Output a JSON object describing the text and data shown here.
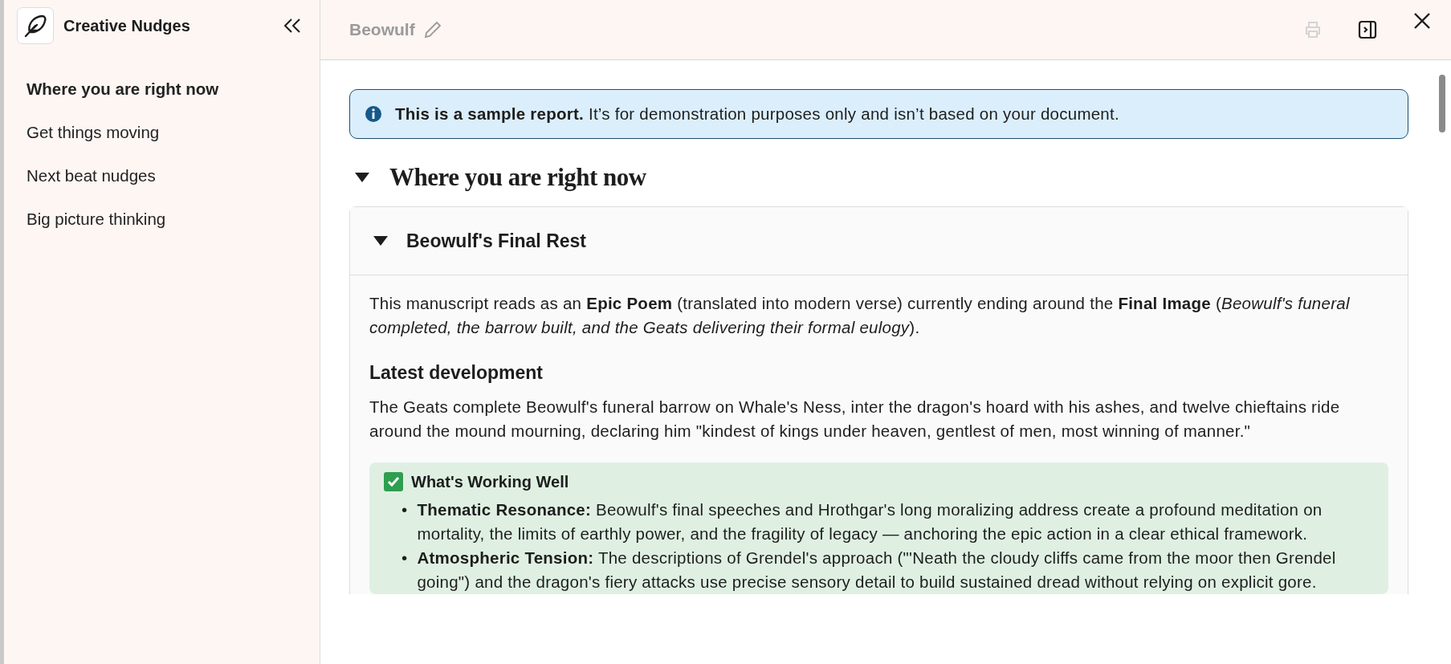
{
  "sidebar": {
    "title": "Creative Nudges",
    "items": [
      {
        "label": "Where you are right now",
        "selected": true
      },
      {
        "label": "Get things moving",
        "selected": false
      },
      {
        "label": "Next beat nudges",
        "selected": false
      },
      {
        "label": "Big picture thinking",
        "selected": false
      }
    ]
  },
  "header": {
    "title": "Beowulf",
    "actions": [
      {
        "kind": "print",
        "disabled": true
      },
      {
        "kind": "panel",
        "disabled": false
      },
      {
        "kind": "close",
        "disabled": false
      }
    ]
  },
  "notice": {
    "text": "**This is a sample report.** It’s for demonstration purposes only and isn’t based on your document."
  },
  "section": {
    "title": "Where you are right now",
    "expanded": true,
    "card": {
      "title": "Beowulf's Final Rest",
      "expanded": true,
      "summary": "This manuscript reads as an **Epic Poem** (translated into modern verse) currently ending around the **Final Image** (*Beowulf's funeral completed, the barrow built, and the Geats delivering their formal eulogy*).",
      "subheading": "Latest development",
      "development": "The Geats complete Beowulf's funeral barrow on Whale's Ness, inter the dragon's hoard with his ashes, and twelve chieftains ride around the mound mourning, declaring him \"kindest of kings under heaven, gentlest of men, most winning of manner.\"",
      "callout": {
        "title": "What's Working Well",
        "checked": true,
        "items": [
          {
            "marker": "•",
            "text": "**Thematic Resonance:** Beowulf's final speeches and Hrothgar's long moralizing address create a profound meditation on mortality, the limits of earthly power, and the fragility of legacy — anchoring the epic action in a clear ethical framework."
          },
          {
            "marker": "•",
            "text": "**Atmospheric Tension:** The descriptions of Grendel's approach (\"'Neath the cloudy cliffs came from the moor then Grendel going\") and the dragon's fiery attacks use precise sensory detail to build sustained dread without relying on explicit gore."
          }
        ]
      }
    }
  }
}
